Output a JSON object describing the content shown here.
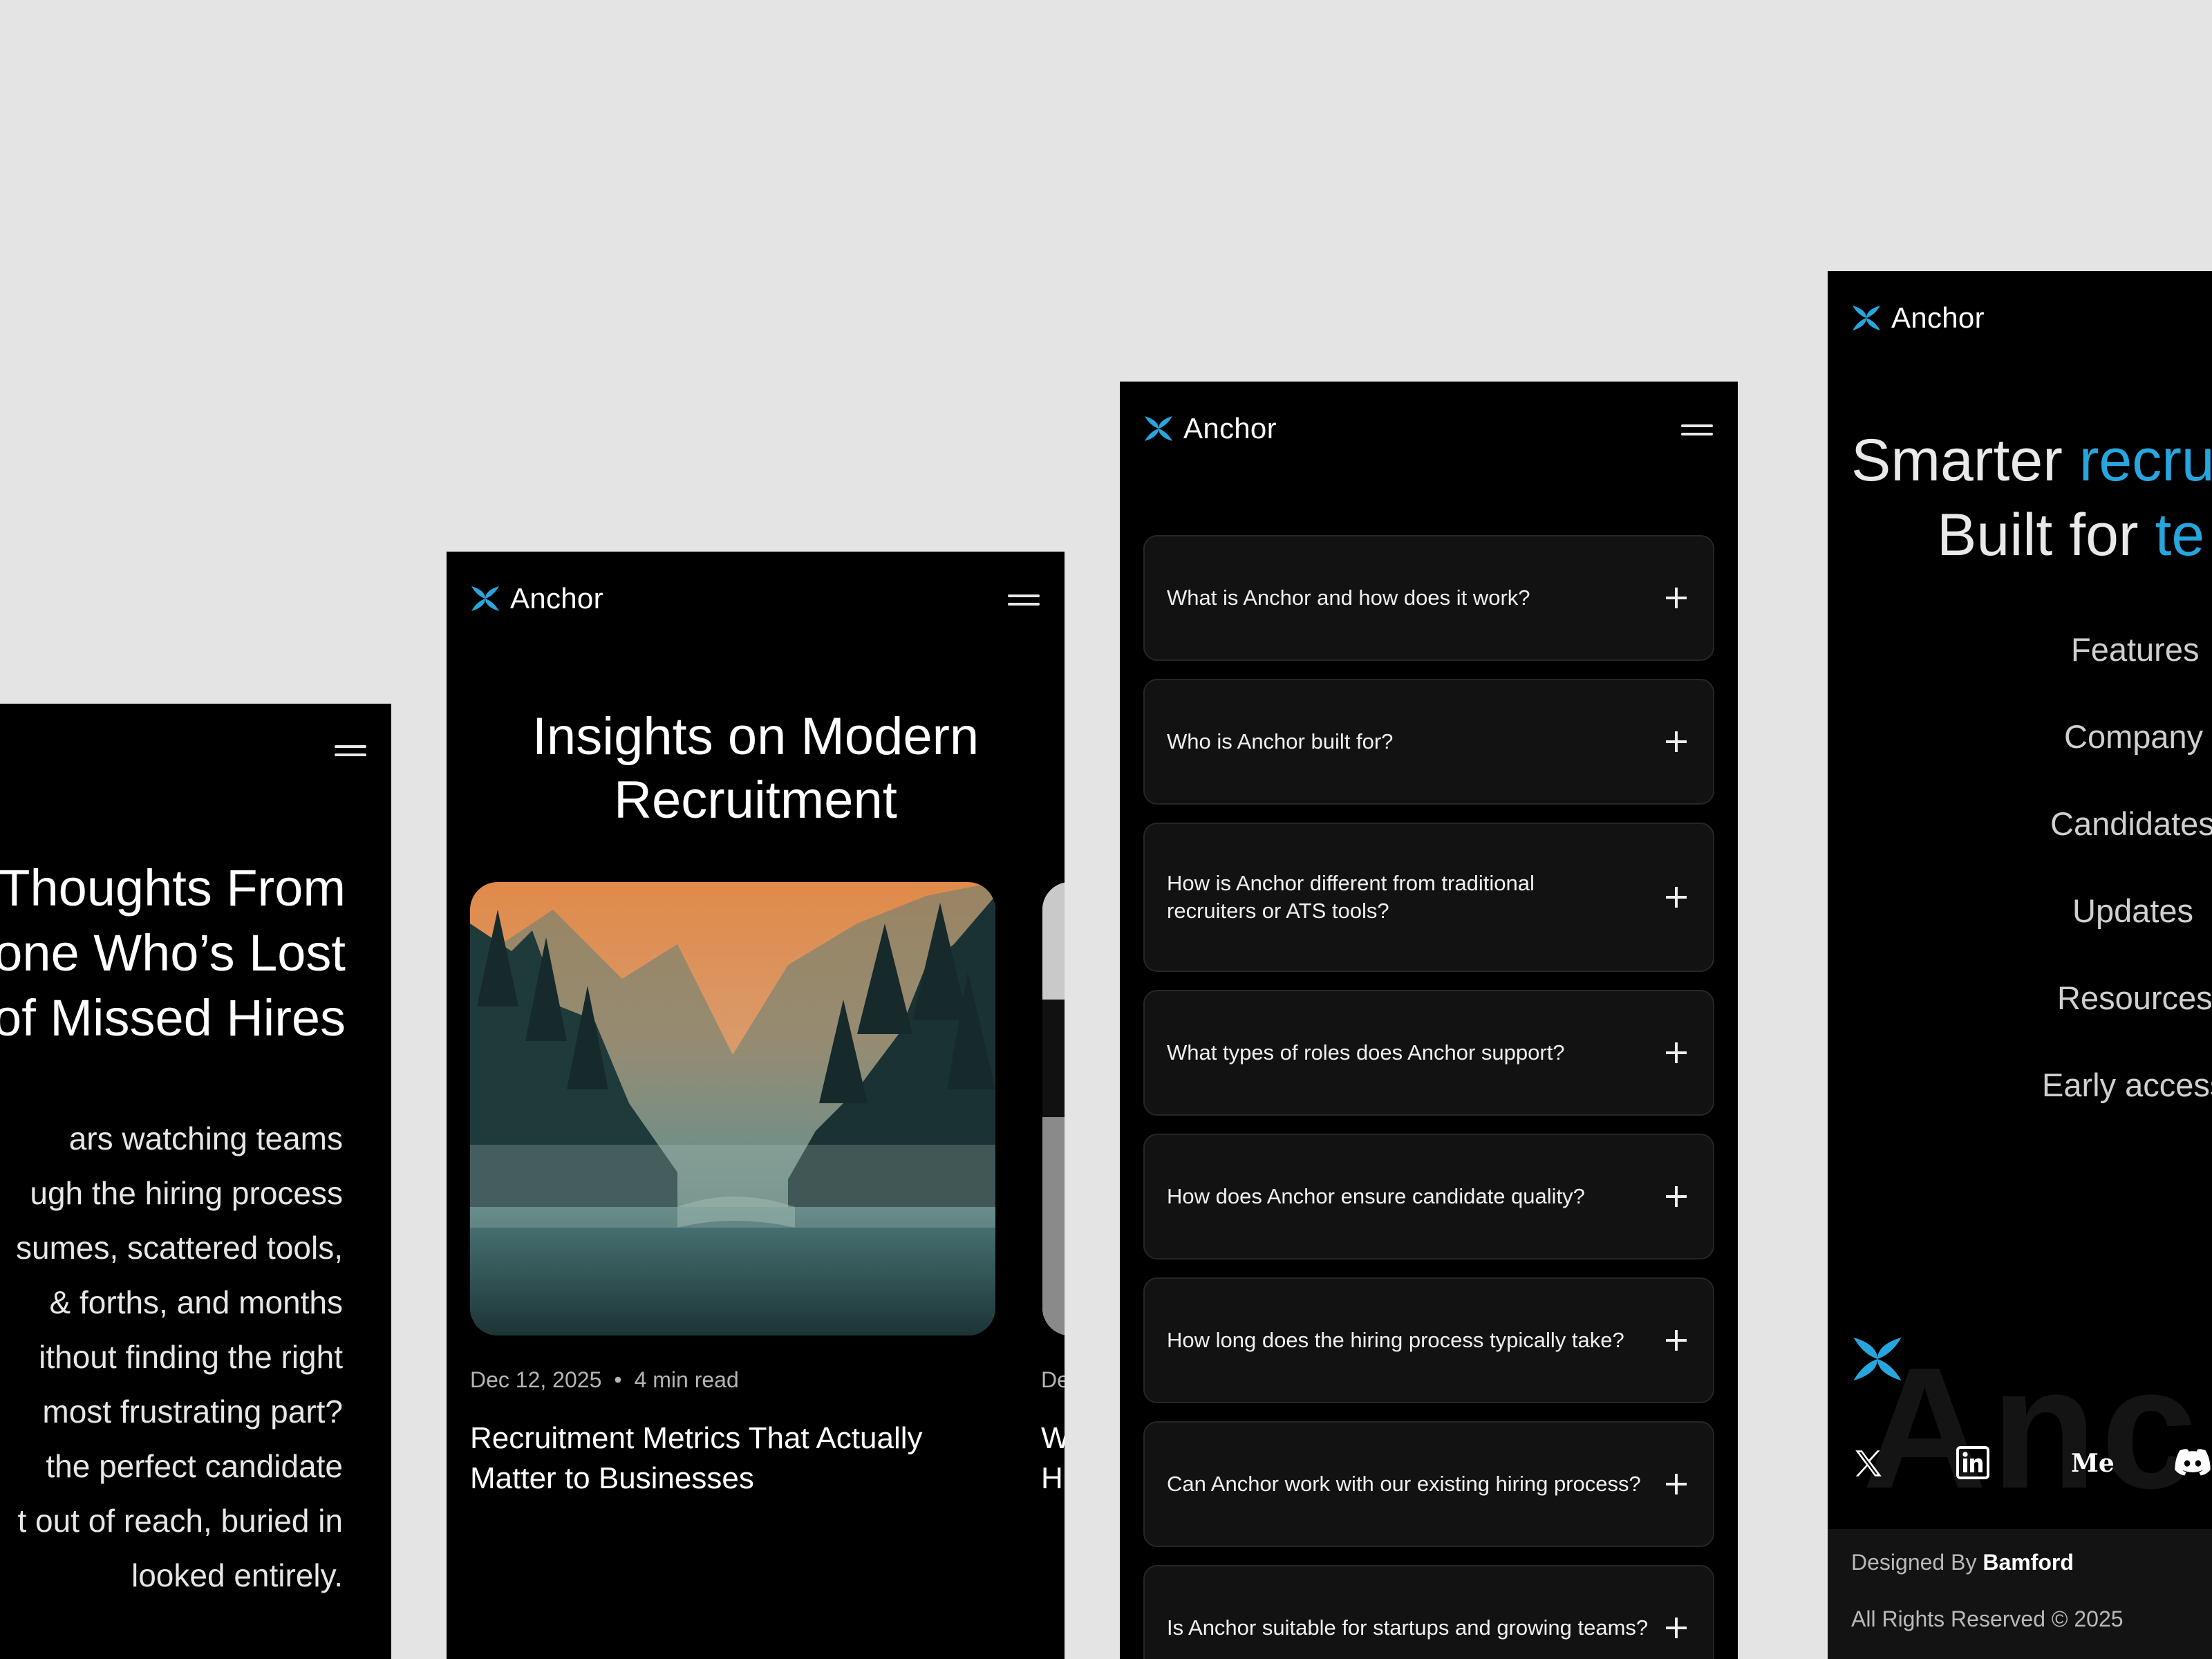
{
  "brand": {
    "name": "Anchor",
    "accent_color": "#27a6de",
    "logo_icon": "anchor-x-logo-icon"
  },
  "phone1": {
    "title_lines": [
      "Thoughts From",
      "one Who’s Lost",
      "of Missed Hires"
    ],
    "body_lines": [
      "ars watching teams",
      "ugh the hiring process",
      "sumes, scattered tools,",
      "& forths, and months",
      "ithout finding the right",
      "most frustrating part?",
      "the perfect candidate",
      "t out of reach, buried in",
      "looked entirely."
    ]
  },
  "phone2": {
    "title_lines": [
      "Insights on Modern",
      "Recruitment"
    ],
    "post": {
      "date": "Dec 12, 2025",
      "separator": "•",
      "read_time": "4 min read",
      "title": "Recruitment Metrics That Actually Matter to Businesses"
    },
    "peek": {
      "meta": "De",
      "title_lines": [
        "W",
        "H"
      ]
    }
  },
  "phone3": {
    "faqs": [
      "What is Anchor and how does it work?",
      "Who is Anchor built for?",
      "How is Anchor different from traditional recruiters or ATS tools?",
      "What types of roles does Anchor support?",
      "How does Anchor ensure candidate quality?",
      "How long does the hiring process typically take?",
      "Can Anchor work with our existing hiring process?",
      "Is Anchor suitable for startups and growing teams?"
    ]
  },
  "phone4": {
    "hero": {
      "line1_plain": "Smarter ",
      "line1_accent": "recru",
      "line2_plain": "Built for ",
      "line2_accent": "te"
    },
    "nav": [
      "Features",
      "Company",
      "Candidates",
      "Updates",
      "Resources",
      "Early access"
    ],
    "watermark": "Anch",
    "social": {
      "x_icon": "x-logo-icon",
      "linkedin_icon": "linkedin-icon",
      "medium_label": "Me",
      "discord_icon": "discord-icon"
    },
    "footer": {
      "designed_by_prefix": "Designed By",
      "designer": "Bamford",
      "rights": "All Rights Reserved © 2025"
    }
  }
}
